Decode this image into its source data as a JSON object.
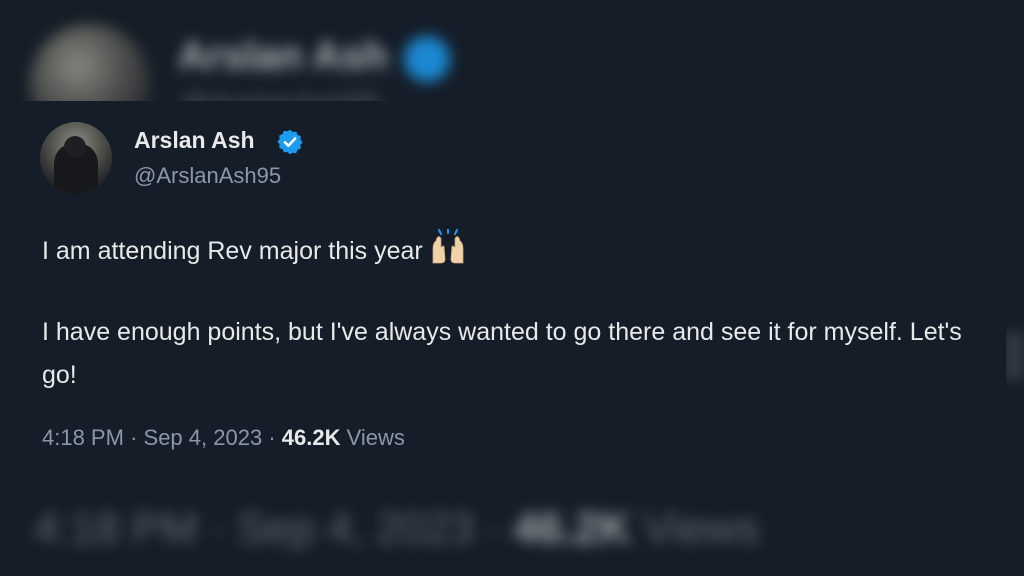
{
  "tweet": {
    "display_name": "Arslan Ash",
    "handle": "@ArslanAsh95",
    "line1": "I am attending Rev major this year",
    "line2": "I have enough points, but I've always wanted to go there and see it for myself. Let's go!",
    "time": "4:18 PM",
    "separator": "·",
    "date": "Sep 4, 2023",
    "views_count": "46.2K",
    "views_label": "Views"
  },
  "icons": {
    "verified": "verified-badge-icon",
    "emoji": "raising-hands-emoji-icon"
  },
  "colors": {
    "background": "#151d28",
    "accent": "#1d9bf0",
    "text_primary": "#e7e9ea",
    "text_secondary": "#8b98a5"
  }
}
